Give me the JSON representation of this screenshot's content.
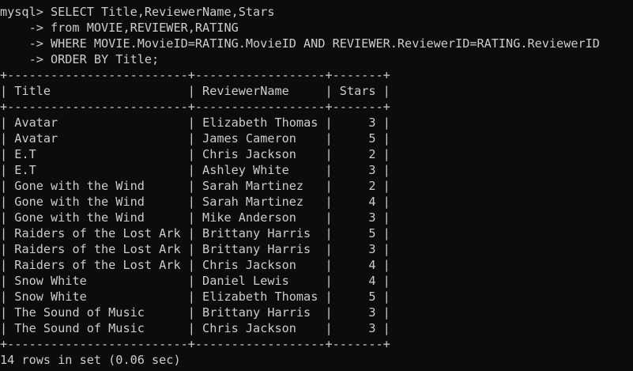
{
  "terminal": {
    "command_lines": [
      "mysql> SELECT Title,ReviewerName,Stars",
      "    -> from MOVIE,REVIEWER,RATING",
      "    -> WHERE MOVIE.MovieID=RATING.MovieID AND REVIEWER.ReviewerID=RATING.ReviewerID",
      "    -> ORDER BY Title;"
    ],
    "table": {
      "columns": [
        "Title",
        "ReviewerName",
        "Stars"
      ],
      "rows": [
        [
          "Avatar",
          "Elizabeth Thomas",
          "3"
        ],
        [
          "Avatar",
          "James Cameron",
          "5"
        ],
        [
          "E.T",
          "Chris Jackson",
          "2"
        ],
        [
          "E.T",
          "Ashley White",
          "3"
        ],
        [
          "Gone with the Wind",
          "Sarah Martinez",
          "2"
        ],
        [
          "Gone with the Wind",
          "Sarah Martinez",
          "4"
        ],
        [
          "Gone with the Wind",
          "Mike Anderson",
          "3"
        ],
        [
          "Raiders of the Lost Ark",
          "Brittany Harris",
          "5"
        ],
        [
          "Raiders of the Lost Ark",
          "Brittany Harris",
          "3"
        ],
        [
          "Raiders of the Lost Ark",
          "Chris Jackson",
          "4"
        ],
        [
          "Snow White",
          "Daniel Lewis",
          "4"
        ],
        [
          "Snow White",
          "Elizabeth Thomas",
          "5"
        ],
        [
          "The Sound of Music",
          "Brittany Harris",
          "3"
        ],
        [
          "The Sound of Music",
          "Chris Jackson",
          "3"
        ]
      ]
    },
    "result_summary": "14 rows in set (0.06 sec)"
  }
}
